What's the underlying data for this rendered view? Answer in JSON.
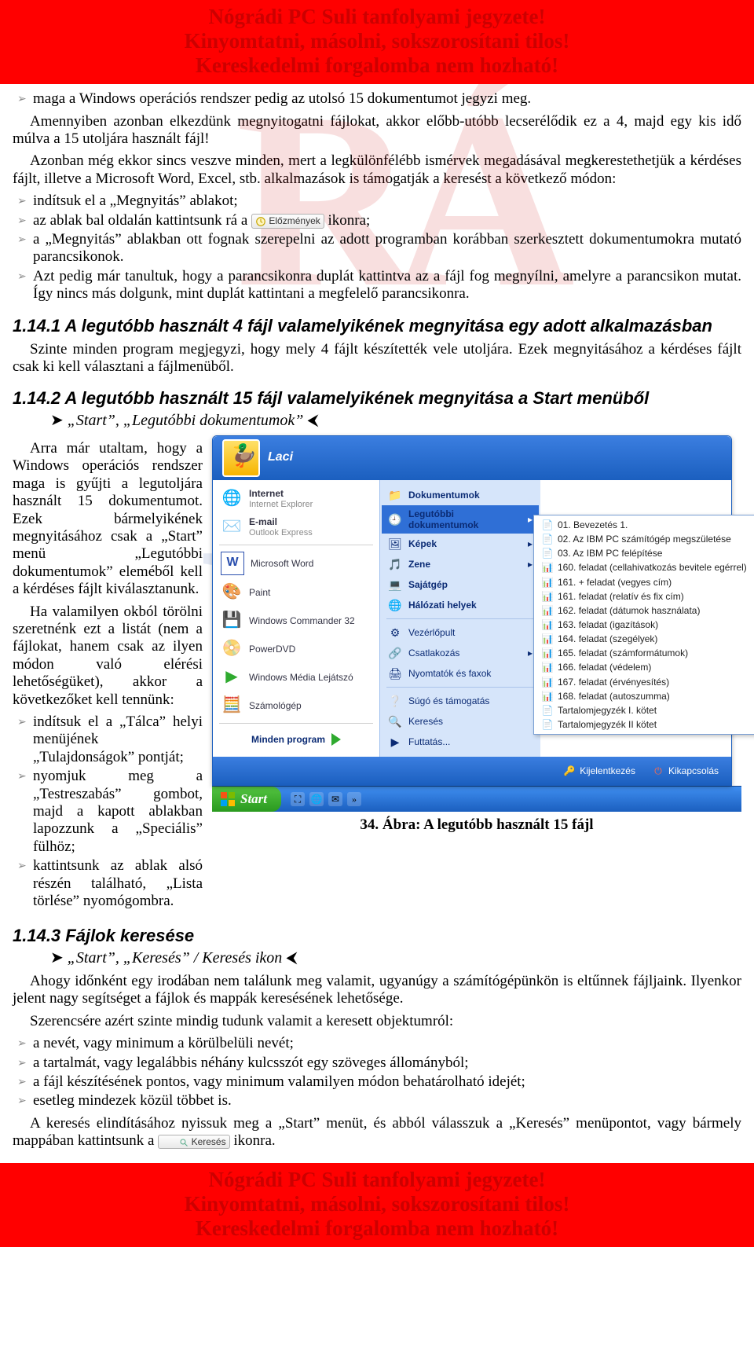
{
  "banner": {
    "line1": "Nógrádi PC Suli tanfolyami jegyzete!",
    "line2": "Kinyomtatni, másolni, sokszorosítani tilos!",
    "line3": "Kereskedelmi forgalomba nem hozható!"
  },
  "intro_bullets": [
    "maga a Windows operációs rendszer pedig az utolsó 15 dokumentumot jegyzi meg."
  ],
  "intro_para1": "Amennyiben azonban elkezdünk megnyitogatni fájlokat, akkor előbb-utóbb lecserélődik ez a 4, majd egy kis idő múlva a 15 utoljára használt fájl!",
  "intro_para2": "Azonban még ekkor sincs veszve minden, mert a legkülönfélébb ismérvek megadásával megkerestethetjük a kérdéses fájlt, illetve a Microsoft Word, Excel, stb. alkalmazások is támogatják a keresést a következő módon:",
  "method_bullets_a": [
    "indítsuk el a „Megnyitás” ablakot;"
  ],
  "method_bullet_icon_pre": "az ablak bal oldalán kattintsunk rá a ",
  "method_bullet_icon_label": "Előzmények",
  "method_bullet_icon_post": " ikonra;",
  "method_bullets_b": [
    "a „Megnyitás” ablakban ott fognak szerepelni az adott programban korábban szerkesztett dokumentumokra mutató parancsikonok.",
    "Azt pedig már tanultuk, hogy a parancsikonra duplát kattintva az a fájl fog megnyílni, amelyre a parancsikon mutat. Így nincs más dolgunk, mint duplát kattintani a megfelelő parancsikonra."
  ],
  "sec1": {
    "title": "1.14.1  A legutóbb használt 4 fájl valamelyikének megnyitása egy adott alkalmazásban",
    "para": "Szinte minden program megjegyzi, hogy mely 4 fájlt készítették vele utoljára. Ezek megnyitásához a kérdéses fájlt csak ki kell választani a fájlmenüből."
  },
  "sec2": {
    "title": "1.14.2  A legutóbb használt 15 fájl valamelyikének megnyitása a Start menüből",
    "path": "„Start”, „Legutóbbi dokumentumok”",
    "left_para1": "Arra már utaltam, hogy a Windows operációs rendszer maga is gyűjti a legutoljára használt 15 dokumentumot. Ezek bármelyikének megnyitásához csak a „Start” menü „Legutóbbi dokumentumok” eleméből kell a kérdéses fájlt kiválasztanunk.",
    "left_para2": "Ha valamilyen okból törölni szeretnénk ezt a listát (nem a fájlokat, hanem csak az ilyen módon való elérési lehetőségüket), akkor a következőket kell tennünk:",
    "left_bullets": [
      "indítsuk el a „Tálca” helyi menüjének „Tulajdonságok” pontját;",
      "nyomjuk meg a „Testreszabás” gombot, majd a kapott ablakban lapozzunk a „Speciális” fülhöz;",
      "kattintsunk az ablak alsó részén található, „Lista törlése” nyomógombra."
    ],
    "figure_caption": "34. Ábra: A legutóbb használt 15 fájl"
  },
  "startmenu": {
    "user": "Laci",
    "left_pinned": [
      {
        "label": "Internet",
        "sub": "Internet Explorer",
        "icon": "🌐"
      },
      {
        "label": "E-mail",
        "sub": "Outlook Express",
        "icon": "✉️"
      }
    ],
    "left_recent": [
      {
        "label": "Microsoft Word",
        "icon": "W"
      },
      {
        "label": "Paint",
        "icon": "🎨"
      },
      {
        "label": "Windows Commander 32",
        "icon": "💾"
      },
      {
        "label": "PowerDVD",
        "icon": "📀"
      },
      {
        "label": "Windows Média Lejátszó",
        "icon": "▶"
      },
      {
        "label": "Számológép",
        "icon": "🧮"
      }
    ],
    "all_programs": "Minden program",
    "right": [
      {
        "label": "Dokumentumok",
        "icon": "📁",
        "bold": true
      },
      {
        "label": "Legutóbbi dokumentumok",
        "icon": "🕘",
        "bold": true,
        "selected": true,
        "arrow": true
      },
      {
        "label": "Képek",
        "icon": "🖼",
        "bold": true,
        "arrow": true
      },
      {
        "label": "Zene",
        "icon": "🎵",
        "bold": true,
        "arrow": true
      },
      {
        "label": "Sajátgép",
        "icon": "💻",
        "bold": true
      },
      {
        "label": "Hálózati helyek",
        "icon": "🌐",
        "bold": true
      }
    ],
    "right2": [
      {
        "label": "Vezérlőpult",
        "icon": "⚙"
      },
      {
        "label": "Csatlakozás",
        "icon": "🔗",
        "arrow": true
      },
      {
        "label": "Nyomtatók és faxok",
        "icon": "🖨"
      }
    ],
    "right3": [
      {
        "label": "Súgó és támogatás",
        "icon": "❔"
      },
      {
        "label": "Keresés",
        "icon": "🔍"
      },
      {
        "label": "Futtatás...",
        "icon": "▶"
      }
    ],
    "footer": {
      "logoff": "Kijelentkezés",
      "shutdown": "Kikapcsolás"
    },
    "start_label": "Start",
    "submenu": [
      "01. Bevezetés 1.",
      "02. Az IBM PC számítógép megszületése",
      "03. Az IBM PC felépítése",
      "160. feladat (cellahivatkozás bevitele egérrel)",
      "161. + feladat (vegyes cím)",
      "161. feladat (relatív és fix cím)",
      "162. feladat (dátumok használata)",
      "163. feladat (igazítások)",
      "164. feladat (szegélyek)",
      "165. feladat (számformátumok)",
      "166. feladat (védelem)",
      "167. feladat (érvényesítés)",
      "168. feladat (autoszumma)",
      "Tartalomjegyzék I. kötet",
      "Tartalomjegyzék II kötet"
    ]
  },
  "sec3": {
    "title": "1.14.3  Fájlok keresése",
    "path": "„Start”, „Keresés” / Keresés ikon",
    "para1": "Ahogy időnként egy irodában nem találunk meg valamit, ugyanúgy a számítógépünkön is eltűnnek fájljaink. Ilyenkor jelent nagy segítséget a fájlok és mappák keresésének lehetősége.",
    "para2": "Szerencsére azért szinte mindig tudunk valamit a keresett objektumról:",
    "bullets": [
      "a nevét, vagy minimum a körülbelüli nevét;",
      "a tartalmát, vagy legalábbis néhány kulcsszót egy szöveges állományból;",
      "a fájl készítésének pontos, vagy minimum valamilyen módon behatárolható idejét;",
      "esetleg mindezek közül többet is."
    ],
    "para3_pre": "A keresés elindításához nyissuk meg a „Start” menüt, és abból válasszuk a „Keresés” menüpontot, vagy bármely mappában kattintsunk a ",
    "para3_icon": "Keresés",
    "para3_post": " ikonra."
  }
}
